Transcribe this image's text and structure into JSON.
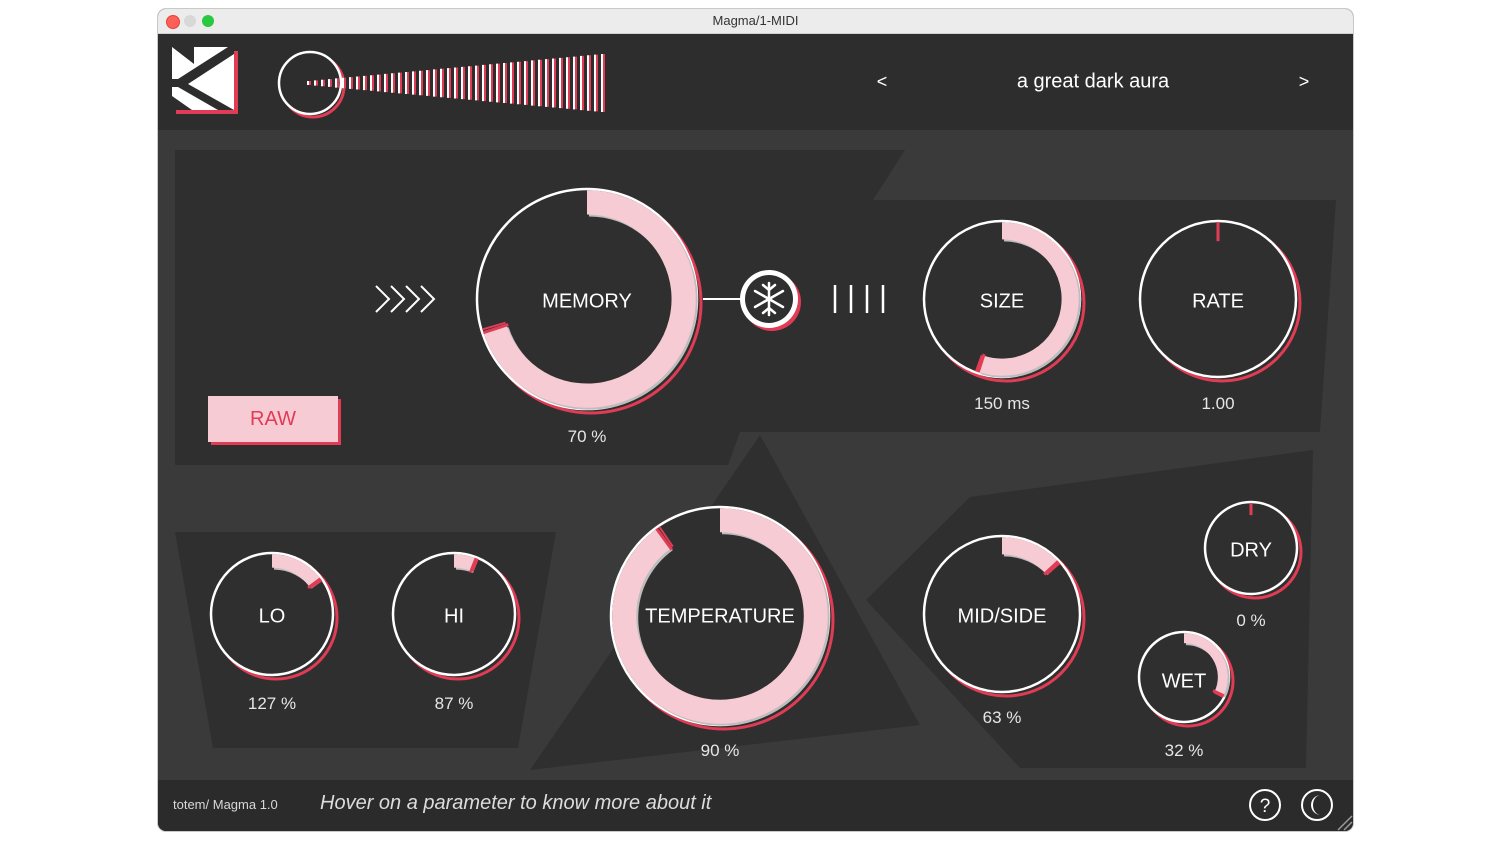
{
  "window": {
    "title": "Magma/1-MIDI"
  },
  "preset": {
    "prev": "<",
    "name": "a great dark aura",
    "next": ">"
  },
  "raw_label": "RAW",
  "knobs": {
    "memory": {
      "label": "MEMORY",
      "value": "70 %",
      "level": 0.7
    },
    "size": {
      "label": "SIZE",
      "value": "150 ms",
      "level": 0.55
    },
    "rate": {
      "label": "RATE",
      "value": "1.00",
      "level": 0.0
    },
    "lo": {
      "label": "LO",
      "value": "127 %",
      "level": 0.15
    },
    "hi": {
      "label": "HI",
      "value": "87 %",
      "level": 0.06
    },
    "temperature": {
      "label": "TEMPERATURE",
      "value": "90 %",
      "level": 0.9
    },
    "midside": {
      "label": "MID/SIDE",
      "value": "63 %",
      "level": 0.13
    },
    "dry": {
      "label": "DRY",
      "value": "0 %",
      "level": 0.0
    },
    "wet": {
      "label": "WET",
      "value": "32 %",
      "level": 0.32
    }
  },
  "footer": {
    "brand": "totem/ Magma 1.0",
    "hint": "Hover on a parameter to know more about it"
  },
  "icons": {
    "help": "help-icon",
    "theme": "moon-icon",
    "freeze": "snowflake-icon"
  },
  "colors": {
    "accent": "#e03c55",
    "pink": "#f7cbd4",
    "bg": "#2f2f2f",
    "panel": "#3a3a3a"
  }
}
